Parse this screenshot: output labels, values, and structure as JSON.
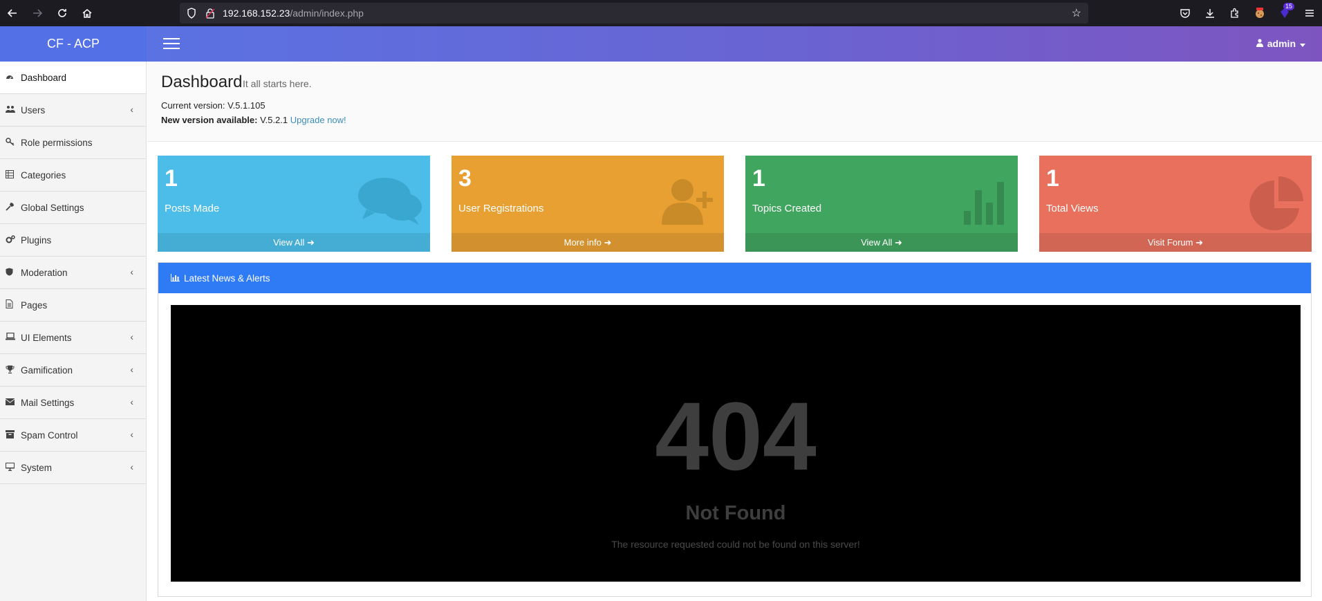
{
  "browser": {
    "url_host": "192.168.152.23",
    "url_path": "/admin/index.php",
    "extension_badge": "15"
  },
  "brand": "CF - ACP",
  "topbar": {
    "user": "admin"
  },
  "sidebar": {
    "items": [
      {
        "label": "Dashboard",
        "icon": "dashboard-icon"
      },
      {
        "label": "Users",
        "icon": "users-icon"
      },
      {
        "label": "Role permissions",
        "icon": "key-icon"
      },
      {
        "label": "Categories",
        "icon": "table-icon"
      },
      {
        "label": "Global Settings",
        "icon": "wrench-icon"
      },
      {
        "label": "Plugins",
        "icon": "cogs-icon"
      },
      {
        "label": "Moderation",
        "icon": "shield-icon"
      },
      {
        "label": "Pages",
        "icon": "file-icon"
      },
      {
        "label": "UI Elements",
        "icon": "laptop-icon"
      },
      {
        "label": "Gamification",
        "icon": "trophy-icon"
      },
      {
        "label": "Mail Settings",
        "icon": "envelope-icon"
      },
      {
        "label": "Spam Control",
        "icon": "archive-icon"
      },
      {
        "label": "System",
        "icon": "desktop-icon"
      }
    ]
  },
  "header": {
    "title": "Dashboard",
    "subtitle": "It all starts here.",
    "current_version_label": "Current version: V.5.1.105",
    "new_version_label": "New version available:",
    "new_version_value": "V.5.2.1",
    "upgrade_link": "Upgrade now!"
  },
  "stats": [
    {
      "value": "1",
      "label": "Posts Made",
      "link": "View All",
      "color": "#4cbde8",
      "icon": "comments-icon"
    },
    {
      "value": "3",
      "label": "User Registrations",
      "link": "More info",
      "color": "#e8a033",
      "icon": "user-plus-icon"
    },
    {
      "value": "1",
      "label": "Topics Created",
      "link": "View All",
      "color": "#40a55f",
      "icon": "bar-chart-icon"
    },
    {
      "value": "1",
      "label": "Total Views",
      "link": "Visit Forum",
      "color": "#e8705c",
      "icon": "pie-chart-icon"
    }
  ],
  "news": {
    "title": "Latest News & Alerts",
    "error_code": "404",
    "error_title": "Not Found",
    "error_message": "The resource requested could not be found on this server!"
  }
}
